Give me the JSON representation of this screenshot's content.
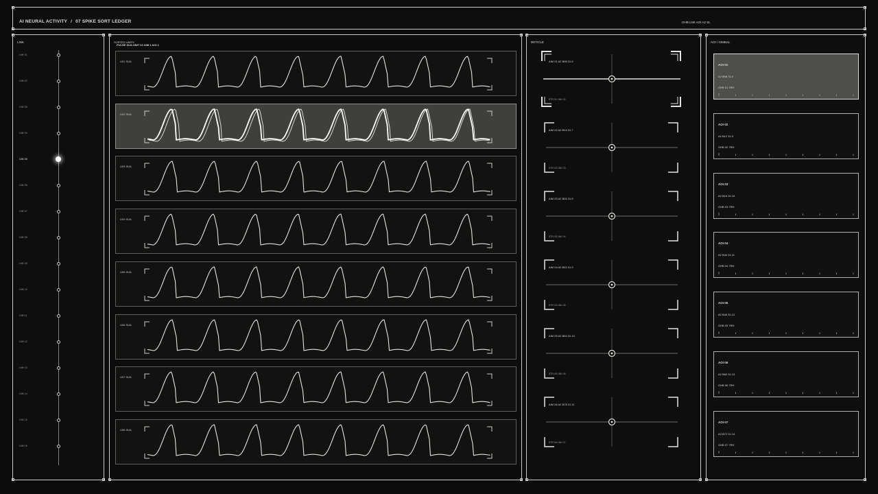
{
  "header": {
    "app": "AI NEURAL ACTIVITY",
    "separator": "/",
    "section": "07  SPIKE SORT LEDGER",
    "readout": "GHB LNK AOI A2 SL"
  },
  "link": {
    "title": "LINK",
    "active_index": 4,
    "items": [
      "LNK 01",
      "LNK 02",
      "LNK 03",
      "LNK 04",
      "LNK 05",
      "LNK 06",
      "LNK 07",
      "LNK 08",
      "LNK 09",
      "LNK 10",
      "LNK 11",
      "LNK 12",
      "LNK 13",
      "LNK 14",
      "LNK 15",
      "LNK 16"
    ]
  },
  "units": {
    "title": "SORTED UNITS",
    "subtitle": "PULSE SUA  UNIT 02  AIM 1  AOI 1",
    "selected_index": 1,
    "rows": [
      "U01 SUA",
      "U02 SUA",
      "U03 SUA",
      "U04 SUA",
      "U05 SUA",
      "U06 SUA",
      "U07 SUA",
      "U08 SUA"
    ]
  },
  "reticle": {
    "title": "RETICLE",
    "cells": [
      {
        "top": "AIM 01  A2 B98 31.6",
        "bottom": "STR 01  LNK 02"
      },
      {
        "top": "AIM 02  A2 B14 31.7",
        "bottom": "STR 02  LNK 03"
      },
      {
        "top": "AIM 03  A2 B26 31.8",
        "bottom": "STR 03  LNK 04"
      },
      {
        "top": "AIM 04  A2 B42 31.9",
        "bottom": "STR 04  LNK 05"
      },
      {
        "top": "AIM 05  A2 B54 31.10",
        "bottom": "STR 05  LNK 06"
      },
      {
        "top": "AIM 06  A2 B78 31.11",
        "bottom": "STR 06  LNK 07"
      }
    ]
  },
  "gimbal": {
    "title": "AOI / GIMBAL",
    "selected_index": 0,
    "cards": [
      {
        "title": "AOI 01",
        "line1": "A2 B98 31.9",
        "line2": "GHB 01  7RH"
      },
      {
        "title": "AOI 02",
        "line1": "A2 B12 31.9",
        "line2": "GHB 02  7RH"
      },
      {
        "title": "AOI 03",
        "line1": "A2 B24 31.10",
        "line2": "GHB 03  7RH"
      },
      {
        "title": "AOI 04",
        "line1": "A2 B34 31.11",
        "line2": "GHB 04  7RH"
      },
      {
        "title": "AOI 05",
        "line1": "A2 B46 31.12",
        "line2": "GHB 05  7RH"
      },
      {
        "title": "AOI 06",
        "line1": "A2 B60 31.13",
        "line2": "GHB 06  7RH"
      },
      {
        "title": "AOI 07",
        "line1": "A2 B72 31.14",
        "line2": "GHB 07  7RH"
      }
    ]
  },
  "colors": {
    "background": "#0b0c0b",
    "line": "#c9ccc6",
    "highlight": "#ffffff"
  }
}
